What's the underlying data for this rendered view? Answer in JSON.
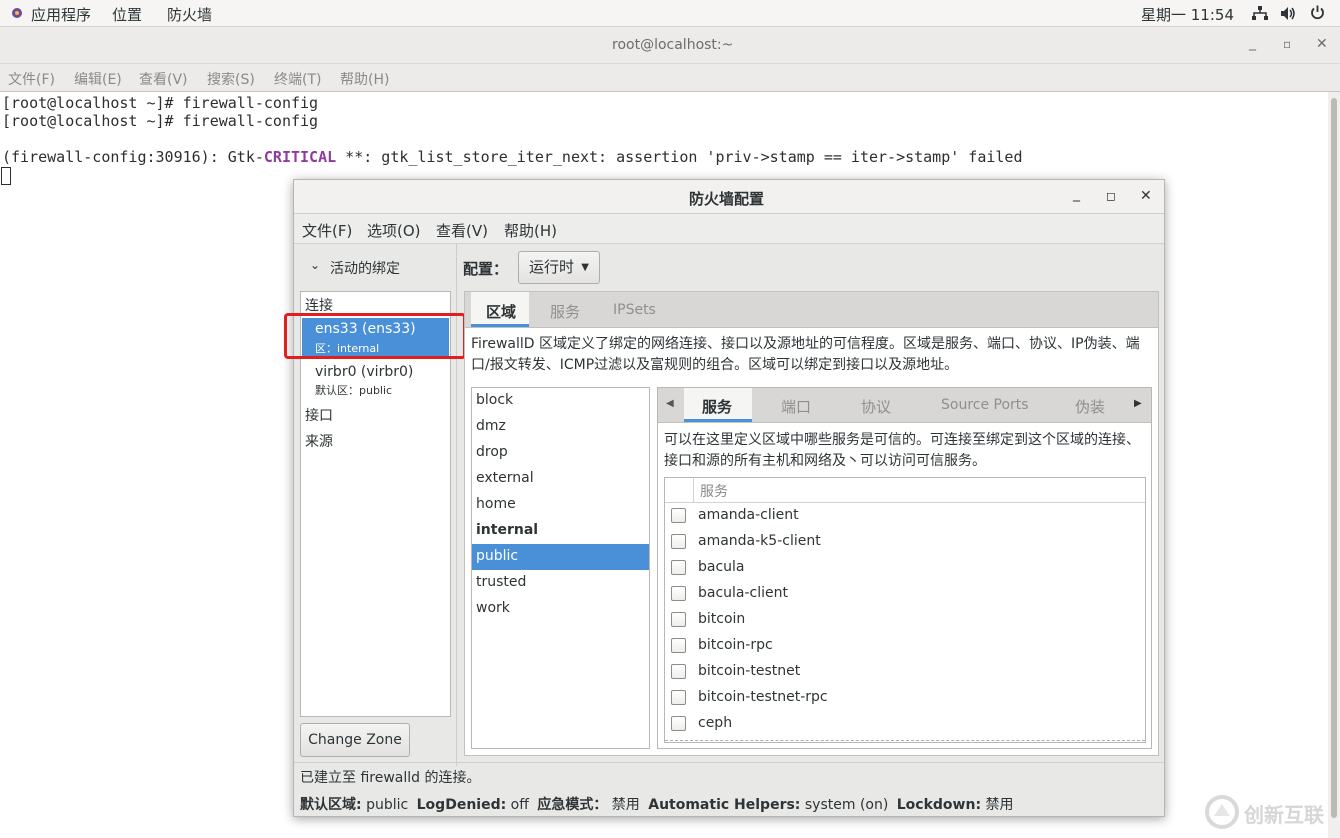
{
  "topbar": {
    "apps_label": "应用程序",
    "places_label": "位置",
    "active_app": "防火墙",
    "clock": "星期一 11:54"
  },
  "terminal": {
    "title": "root@localhost:~",
    "menu": [
      "文件(F)",
      "编辑(E)",
      "查看(V)",
      "搜索(S)",
      "终端(T)",
      "帮助(H)"
    ],
    "lines": [
      "[root@localhost ~]# firewall-config",
      "[root@localhost ~]# firewall-config"
    ],
    "error_prefix": "(firewall-config:30916): Gtk-",
    "error_level": "CRITICAL",
    "error_suffix": " **: gtk_list_store_iter_next: assertion 'priv->stamp == iter->stamp' failed"
  },
  "dialog": {
    "title": "防火墙配置",
    "menu": [
      "文件(F)",
      "选项(O)",
      "查看(V)",
      "帮助(H)"
    ],
    "left": {
      "section_title": "活动的绑定",
      "connections_header": "连接",
      "connections": [
        {
          "name": "ens33 (ens33)",
          "zone": "区：internal"
        },
        {
          "name": "virbr0 (virbr0)",
          "zone": "默认区：public"
        }
      ],
      "interfaces_header": "接口",
      "sources_header": "来源",
      "change_zone_button": "Change Zone"
    },
    "config_label": "配置：",
    "config_value": "运行时",
    "outer_tabs": [
      "区域",
      "服务",
      "IPSets"
    ],
    "zone_description": "FirewallD 区域定义了绑定的网络连接、接口以及源地址的可信程度。区域是服务、端口、协议、IP伪装、端口/报文转发、ICMP过滤以及富规则的组合。区域可以绑定到接口以及源地址。",
    "zones": [
      "block",
      "dmz",
      "drop",
      "external",
      "home",
      "internal",
      "public",
      "trusted",
      "work"
    ],
    "selected_zone": "public",
    "bold_zone": "internal",
    "inner_tabs": [
      "服务",
      "端口",
      "协议",
      "Source Ports",
      "伪装"
    ],
    "services_description": "可以在这里定义区域中哪些服务是可信的。可连接至绑定到这个区域的连接、接口和源的所有主机和网络及丶可以访问可信服务。",
    "services_header": "服务",
    "services": [
      "amanda-client",
      "amanda-k5-client",
      "bacula",
      "bacula-client",
      "bitcoin",
      "bitcoin-rpc",
      "bitcoin-testnet",
      "bitcoin-testnet-rpc",
      "ceph"
    ],
    "status_line": "已建立至 firewalld 的连接。",
    "status": {
      "default_zone_label": "默认区域:",
      "default_zone_value": "public",
      "logdenied_label": "LogDenied:",
      "logdenied_value": "off",
      "panic_label": "应急模式：",
      "panic_value": "禁用",
      "helpers_label": "Automatic Helpers:",
      "helpers_value": "system (on)",
      "lockdown_label": "Lockdown:",
      "lockdown_value": "禁用"
    }
  },
  "watermark": "创新互联",
  "colors": {
    "selection": "#4a90d9",
    "highlight_box": "#e02020",
    "critical": "#8f3b9e"
  }
}
